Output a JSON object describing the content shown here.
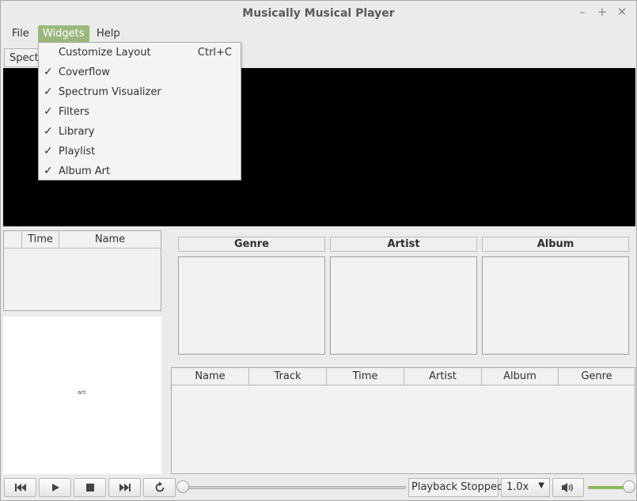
{
  "window": {
    "title": "Musically Musical Player"
  },
  "menubar": {
    "file": "File",
    "widgets": "Widgets",
    "help": "Help"
  },
  "toolbar": {
    "tab_label": "Spectr"
  },
  "widgets_menu": {
    "customize": {
      "label": "Customize Layout",
      "shortcut": "Ctrl+C"
    },
    "items": [
      {
        "label": "Coverflow",
        "checked": true
      },
      {
        "label": "Spectrum Visualizer",
        "checked": true
      },
      {
        "label": "Filters",
        "checked": true
      },
      {
        "label": "Library",
        "checked": true
      },
      {
        "label": "Playlist",
        "checked": true
      },
      {
        "label": "Album Art",
        "checked": true
      }
    ]
  },
  "playlist_headers": [
    "",
    "Time",
    "Name"
  ],
  "filters": {
    "genre": "Genre",
    "artist": "Artist",
    "album": "Album"
  },
  "library_headers": [
    "Name",
    "Track",
    "Time",
    "Artist",
    "Album",
    "Genre"
  ],
  "album_art": {
    "caption": "art."
  },
  "controls": {
    "status": "Playback Stopped",
    "speed": "1.0x"
  },
  "colors": {
    "accent": "#9ab87c",
    "visualizer_bg": "#000000",
    "volume": "#8ab85f"
  }
}
